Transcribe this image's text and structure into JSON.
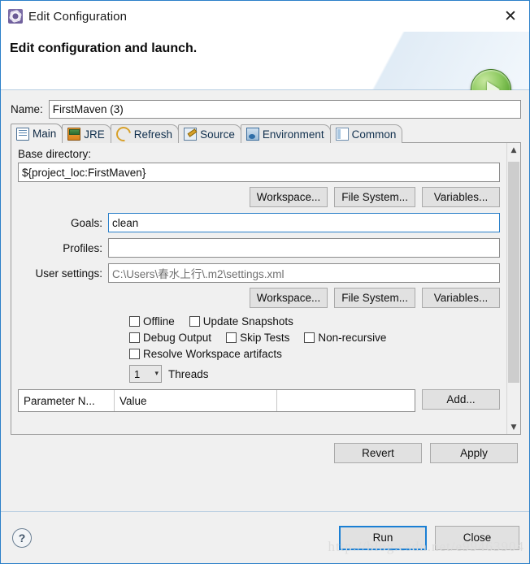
{
  "window": {
    "title": "Edit Configuration",
    "icon": "gear-icon",
    "close_label": "✕"
  },
  "header": {
    "title": "Edit configuration and launch.",
    "badge_icon": "run-play-icon"
  },
  "name_field": {
    "label": "Name:",
    "value": "FirstMaven (3)"
  },
  "tabs": [
    {
      "label": "Main",
      "icon": "main-icon",
      "active": true
    },
    {
      "label": "JRE",
      "icon": "jre-icon",
      "active": false
    },
    {
      "label": "Refresh",
      "icon": "refresh-icon",
      "active": false
    },
    {
      "label": "Source",
      "icon": "source-icon",
      "active": false
    },
    {
      "label": "Environment",
      "icon": "environment-icon",
      "active": false
    },
    {
      "label": "Common",
      "icon": "common-icon",
      "active": false
    }
  ],
  "main_tab": {
    "base_directory": {
      "label": "Base directory:",
      "value": "${project_loc:FirstMaven}"
    },
    "dir_buttons": [
      "Workspace...",
      "File System...",
      "Variables..."
    ],
    "goals": {
      "label": "Goals:",
      "value": "clean"
    },
    "profiles": {
      "label": "Profiles:",
      "value": ""
    },
    "user_settings": {
      "label": "User settings:",
      "value": "C:\\Users\\春水上行\\.m2\\settings.xml"
    },
    "settings_buttons": [
      "Workspace...",
      "File System...",
      "Variables..."
    ],
    "checkboxes": [
      [
        {
          "label": "Offline",
          "checked": false
        },
        {
          "label": "Update Snapshots",
          "checked": false
        }
      ],
      [
        {
          "label": "Debug Output",
          "checked": false
        },
        {
          "label": "Skip Tests",
          "checked": false
        },
        {
          "label": "Non-recursive",
          "checked": false
        }
      ],
      [
        {
          "label": "Resolve Workspace artifacts",
          "checked": false
        }
      ]
    ],
    "threads": {
      "value": "1",
      "label": "Threads"
    },
    "parameter_table": {
      "columns": [
        "Parameter N...",
        "Value",
        ""
      ],
      "rows": [],
      "add_label": "Add..."
    }
  },
  "panel_buttons": {
    "revert": "Revert",
    "apply": "Apply"
  },
  "footer": {
    "help_label": "?",
    "run_label": "Run",
    "close_label": "Close",
    "watermark": "http://blog.csdn.net/e99463904"
  },
  "colors": {
    "accent": "#2a7fc9",
    "run_green": "#6cb33f",
    "panel_bg": "#f0f0f0",
    "title_icon": "#6f5f9c"
  }
}
